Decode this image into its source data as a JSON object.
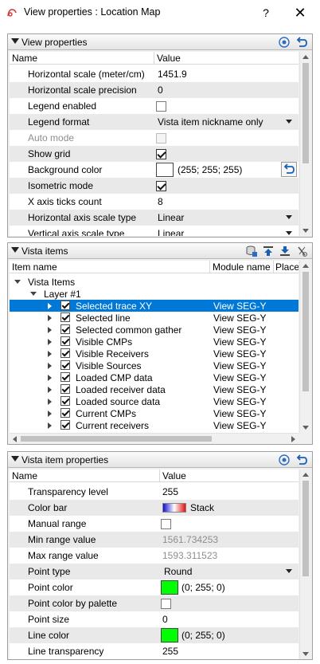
{
  "window": {
    "title": "View properties : Location Map",
    "help_glyph": "?",
    "close_glyph": "✕",
    "app_icon": "app-icon"
  },
  "view_properties": {
    "title": "View properties",
    "columns": [
      "Name",
      "Value"
    ],
    "rows": [
      {
        "name": "Horizontal scale (meter/cm)",
        "value": "1451.9"
      },
      {
        "name": "Horizontal scale precision",
        "value": "0"
      },
      {
        "name": "Legend enabled",
        "checked": false
      },
      {
        "name": "Legend format",
        "value": "Vista item nickname only"
      },
      {
        "name": "Auto mode",
        "checked": false
      },
      {
        "name": "Show grid",
        "checked": true
      },
      {
        "name": "Background color",
        "value": "(255; 255; 255)",
        "color": "#ffffff"
      },
      {
        "name": "Isometric mode",
        "checked": true
      },
      {
        "name": "X axis ticks count",
        "value": "8"
      },
      {
        "name": "Horizontal axis scale type",
        "value": "Linear"
      },
      {
        "name": "Vertical axis scale type",
        "value": "Linear"
      }
    ]
  },
  "vista_items": {
    "title": "Vista items",
    "columns": [
      "Item name",
      "Module name",
      "Place"
    ],
    "root": "Vista Items",
    "layer": "Layer  #1",
    "items": [
      {
        "name": "Selected trace XY",
        "module": "View SEG-Y"
      },
      {
        "name": "Selected line",
        "module": "View SEG-Y"
      },
      {
        "name": "Selected common gather",
        "module": "View SEG-Y"
      },
      {
        "name": "Visible CMPs",
        "module": "View SEG-Y"
      },
      {
        "name": "Visible Receivers",
        "module": "View SEG-Y"
      },
      {
        "name": "Visible Sources",
        "module": "View SEG-Y"
      },
      {
        "name": "Loaded CMP data",
        "module": "View SEG-Y"
      },
      {
        "name": "Loaded receiver data",
        "module": "View SEG-Y"
      },
      {
        "name": "Loaded source data",
        "module": "View SEG-Y"
      },
      {
        "name": "Current CMPs",
        "module": "View SEG-Y"
      },
      {
        "name": "Current receivers",
        "module": "View SEG-Y"
      }
    ]
  },
  "vista_item_properties": {
    "title": "Vista item properties",
    "columns": [
      "Name",
      "Value"
    ],
    "rows": [
      {
        "name": "Transparency level",
        "value": "255"
      },
      {
        "name": "Color bar",
        "value": "Stack"
      },
      {
        "name": "Manual range",
        "checked": false
      },
      {
        "name": "Min range value",
        "value": "1561.734253"
      },
      {
        "name": "Max range value",
        "value": "1593.311523"
      },
      {
        "name": "Point type",
        "value": "Round"
      },
      {
        "name": "Point color",
        "value": "(0; 255; 0)",
        "color": "#00ff00"
      },
      {
        "name": "Point color by palette",
        "checked": false
      },
      {
        "name": "Point size",
        "value": "0"
      },
      {
        "name": "Line color",
        "value": "(0; 255; 0)",
        "color": "#00ff00"
      },
      {
        "name": "Line transparency",
        "value": "255"
      }
    ]
  },
  "colors": {
    "selection": "#0078d7",
    "accent": "#1a5fb4"
  }
}
